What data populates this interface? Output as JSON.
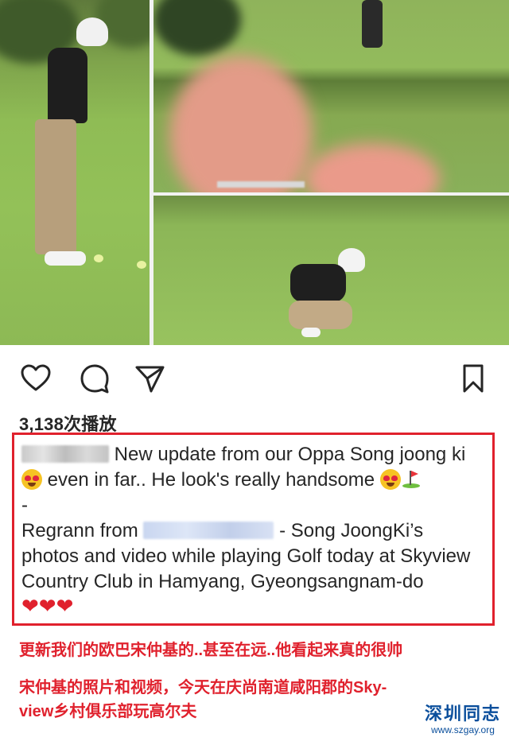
{
  "post": {
    "views": "3,138次播放",
    "caption": {
      "line1_text": "New update from our Oppa Song joong ki",
      "line2_text": "even in far.. He look's really handsome",
      "line3_text": "-",
      "line4_prefix": "Regrann from",
      "line4_suffix": "-  Song JoongKi’s",
      "line5_text": "photos and video while playing Golf today at Skyview",
      "line6_text": "Country Club in Hamyang, Gyeongsangnam-do",
      "hearts": "❤❤❤"
    }
  },
  "translation": {
    "line1": "更新我们的欧巴宋仲基的..甚至在远..他看起来真的很帅",
    "line2": "宋仲基的照片和视频，今天在庆尚南道咸阳郡的Sky-",
    "line3": "view乡村俱乐部玩高尔夫"
  },
  "watermark": {
    "title": "深圳同志",
    "url": "www.szgay.org"
  },
  "icons": {
    "like": "heart-outline-icon",
    "comment": "comment-bubble-icon",
    "share": "paper-plane-icon",
    "save": "bookmark-icon"
  },
  "colors": {
    "highlight_border": "#e0212d",
    "translation_text": "#e0212d",
    "watermark": "#0b4f9c"
  }
}
